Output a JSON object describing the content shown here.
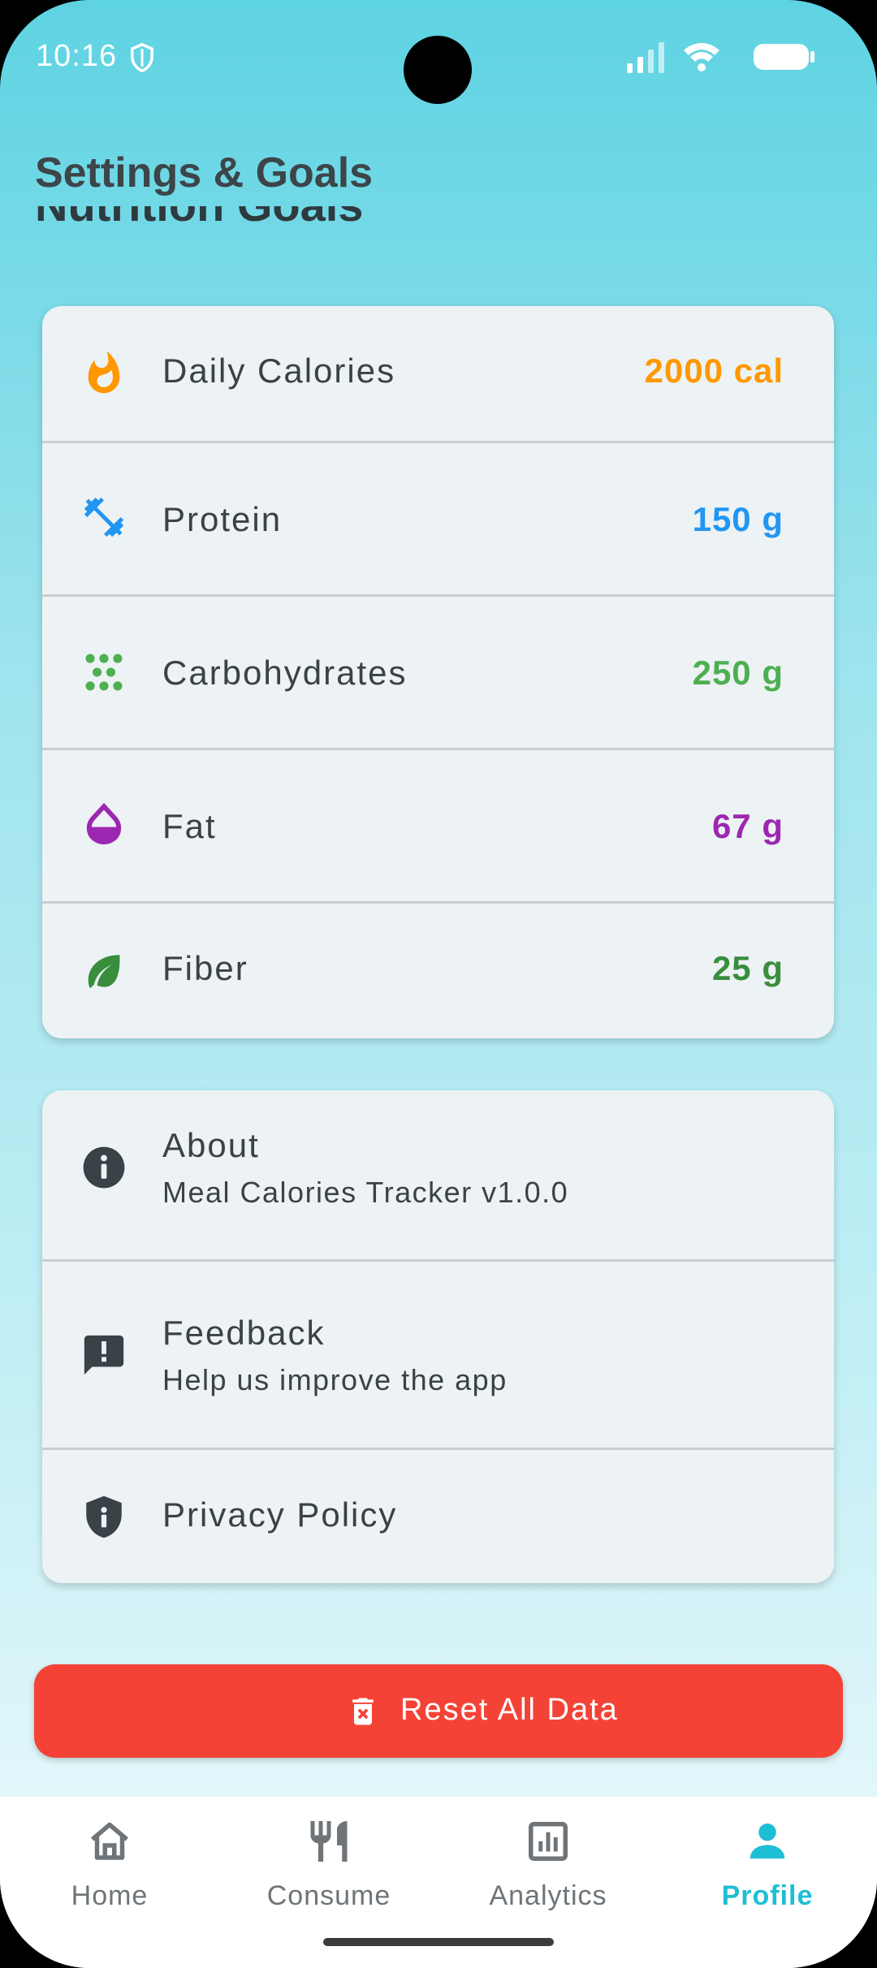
{
  "status_bar": {
    "time": "10:16"
  },
  "header": {
    "title": "Settings & Goals",
    "section_heading": "Nutrition Goals"
  },
  "goals": [
    {
      "label": "Daily Calories",
      "value": "2000 cal",
      "color": "#FF9800",
      "icon": "fire-icon"
    },
    {
      "label": "Protein",
      "value": "150 g",
      "color": "#2196F3",
      "icon": "dumbbell-icon"
    },
    {
      "label": "Carbohydrates",
      "value": "250 g",
      "color": "#4CAF50",
      "icon": "grain-icon"
    },
    {
      "label": "Fat",
      "value": "67 g",
      "color": "#9C27B0",
      "icon": "drop-icon"
    },
    {
      "label": "Fiber",
      "value": "25 g",
      "color": "#388E3C",
      "icon": "leaf-icon"
    }
  ],
  "info": [
    {
      "title": "About",
      "subtitle": "Meal Calories Tracker v1.0.0",
      "icon": "info-icon"
    },
    {
      "title": "Feedback",
      "subtitle": "Help us improve the app",
      "icon": "feedback-icon"
    },
    {
      "title": "Privacy Policy",
      "icon": "shield-icon"
    }
  ],
  "reset_button": {
    "label": "Reset All Data",
    "color": "#F44336"
  },
  "nav": [
    {
      "label": "Home",
      "icon": "home-icon"
    },
    {
      "label": "Consume",
      "icon": "utensils-icon"
    },
    {
      "label": "Analytics",
      "icon": "analytics-icon"
    },
    {
      "label": "Profile",
      "icon": "person-icon",
      "active": true
    }
  ],
  "colors": {
    "accent": "#1EBED4",
    "text": "#3A4247"
  }
}
